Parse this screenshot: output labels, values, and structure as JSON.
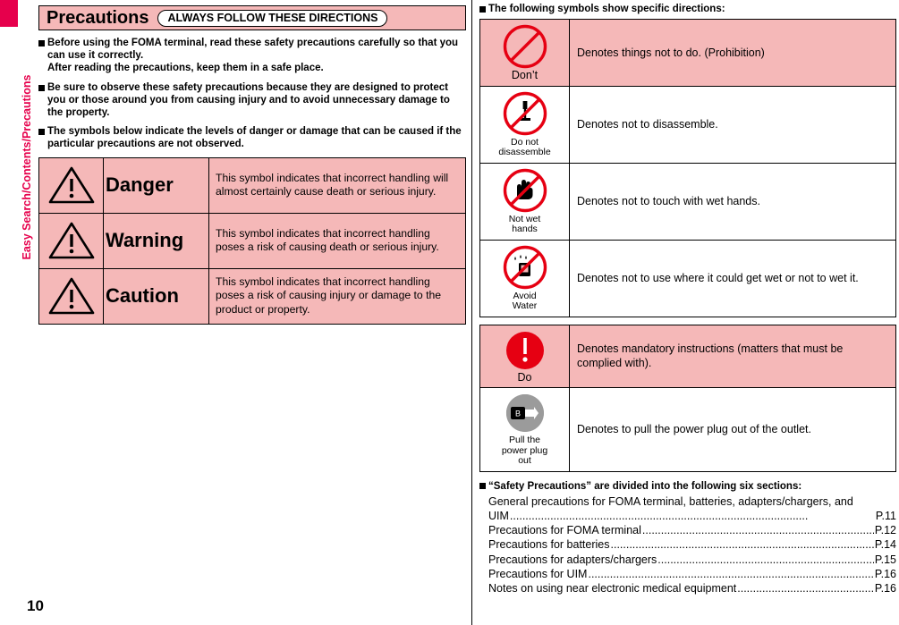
{
  "side_tab": {
    "label": "Easy Search/Contents/Precautions"
  },
  "page_number": "10",
  "left": {
    "title": "Precautions",
    "title_pill": "ALWAYS FOLLOW THESE DIRECTIONS",
    "bullets": [
      "Before using the FOMA terminal, read these safety precautions carefully so that you can use it correctly.\nAfter reading the precautions, keep them in a safe place.",
      "Be sure to observe these safety precautions because they are designed to protect you or those around you from causing injury and to avoid unnecessary damage to the property.",
      "The symbols below indicate the levels of danger or damage that can be caused if the particular precautions are not observed."
    ],
    "levels": [
      {
        "icon": "warning-triangle-icon",
        "word": "Danger",
        "desc": "This symbol indicates that incorrect handling will almost certainly cause death or serious injury."
      },
      {
        "icon": "warning-triangle-icon",
        "word": "Warning",
        "desc": "This symbol indicates that incorrect handling poses a risk of causing death or serious injury."
      },
      {
        "icon": "warning-triangle-icon",
        "word": "Caution",
        "desc": "This symbol indicates that incorrect handling poses a risk of causing injury or damage to the product or property."
      }
    ]
  },
  "right": {
    "heading": "The following symbols show specific directions:",
    "prohibition_rows": [
      {
        "icon": "prohibition-icon",
        "caption": "Don’t",
        "desc": "Denotes things not to do. (Prohibition)"
      },
      {
        "icon": "no-disassemble-icon",
        "caption": "Do not\ndisassemble",
        "desc": "Denotes not to disassemble."
      },
      {
        "icon": "no-wet-hands-icon",
        "caption": "Not wet\nhands",
        "desc": "Denotes not to touch with wet hands."
      },
      {
        "icon": "avoid-water-icon",
        "caption": "Avoid\nWater",
        "desc": "Denotes not to use where it could get wet or not to wet it."
      }
    ],
    "mandatory_rows": [
      {
        "icon": "mandatory-icon",
        "caption": "Do",
        "desc": "Denotes mandatory instructions (matters that must be complied with)."
      },
      {
        "icon": "unplug-power-icon",
        "caption": "Pull the\npower plug\nout",
        "desc": "Denotes to pull the power plug out of the outlet."
      }
    ],
    "sections_heading": "“Safety Precautions” are divided into the following six sections:",
    "toc": [
      {
        "name": "General precautions for FOMA terminal, batteries, adapters/chargers, and UIM",
        "page": "P.11",
        "wrap": true
      },
      {
        "name": "Precautions for FOMA terminal",
        "page": "P.12",
        "wrap": false
      },
      {
        "name": "Precautions for batteries",
        "page": "P.14",
        "wrap": false
      },
      {
        "name": "Precautions for adapters/chargers",
        "page": "P.15",
        "wrap": false
      },
      {
        "name": "Precautions for UIM",
        "page": "P.16",
        "wrap": false
      },
      {
        "name": "Notes on using near electronic medical equipment",
        "page": "P.16",
        "wrap": false
      }
    ],
    "toc_wrap_first": "General precautions for FOMA terminal, batteries, adapters/chargers, and",
    "toc_wrap_second": "UIM"
  },
  "colors": {
    "accent": "#e6004c",
    "pink_fill": "#f5b8b8",
    "prohibit_red": "#e60012"
  }
}
